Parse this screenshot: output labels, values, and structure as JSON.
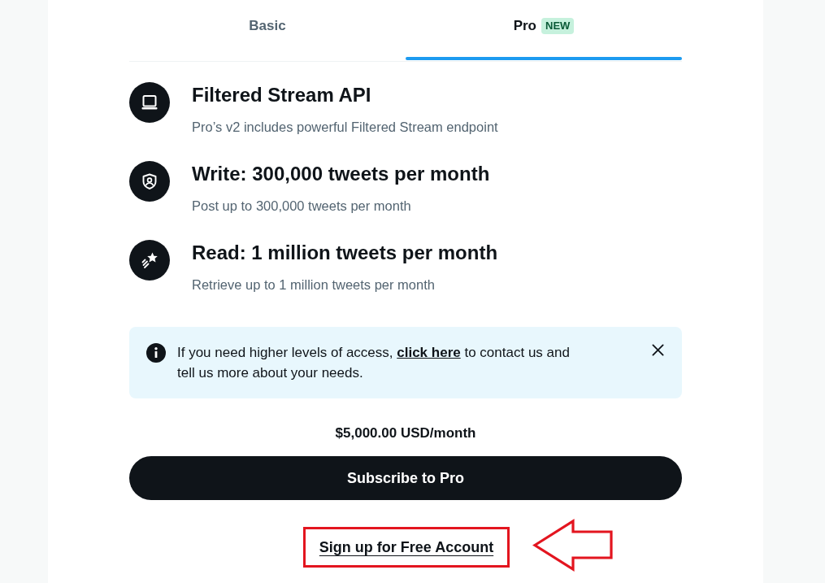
{
  "tabs": [
    {
      "label": "Basic",
      "selected": false
    },
    {
      "label": "Pro",
      "selected": true,
      "badge": "NEW"
    }
  ],
  "features": [
    {
      "kind": "stream",
      "title": "Filtered Stream API",
      "description": "Pro’s v2 includes powerful Filtered Stream endpoint"
    },
    {
      "kind": "write",
      "title": "Write: 300,000 tweets per month",
      "description": "Post up to 300,000 tweets per month"
    },
    {
      "kind": "read",
      "title": "Read: 1 million tweets per month",
      "description": "Retrieve up to 1 million tweets per month"
    }
  ],
  "notice": {
    "text_before": "If you need higher levels of access,",
    "link": "click here",
    "text_after": "to contact us and tell us more about your needs."
  },
  "price": "$5,000.00 USD/month",
  "subscribe_button": "Subscribe to Pro",
  "signup_link": {
    "label": "Sign up for Free Account",
    "highlighted": true
  }
}
